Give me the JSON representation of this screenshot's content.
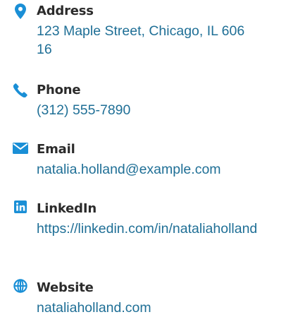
{
  "accent_color": "#1a8fd6",
  "contacts": [
    {
      "icon": "map-pin-icon",
      "label": "Address",
      "value": "123 Maple Street, Chicago, IL 60616"
    },
    {
      "icon": "phone-icon",
      "label": "Phone",
      "value": "(312) 555-7890"
    },
    {
      "icon": "envelope-icon",
      "label": "Email",
      "value": "natalia.holland@example.com"
    },
    {
      "icon": "linkedin-icon",
      "label": "LinkedIn",
      "value": "https://linkedin.com/in/nataliaholland"
    },
    {
      "icon": "globe-icon",
      "label": "Website",
      "value": "nataliaholland.com"
    }
  ]
}
